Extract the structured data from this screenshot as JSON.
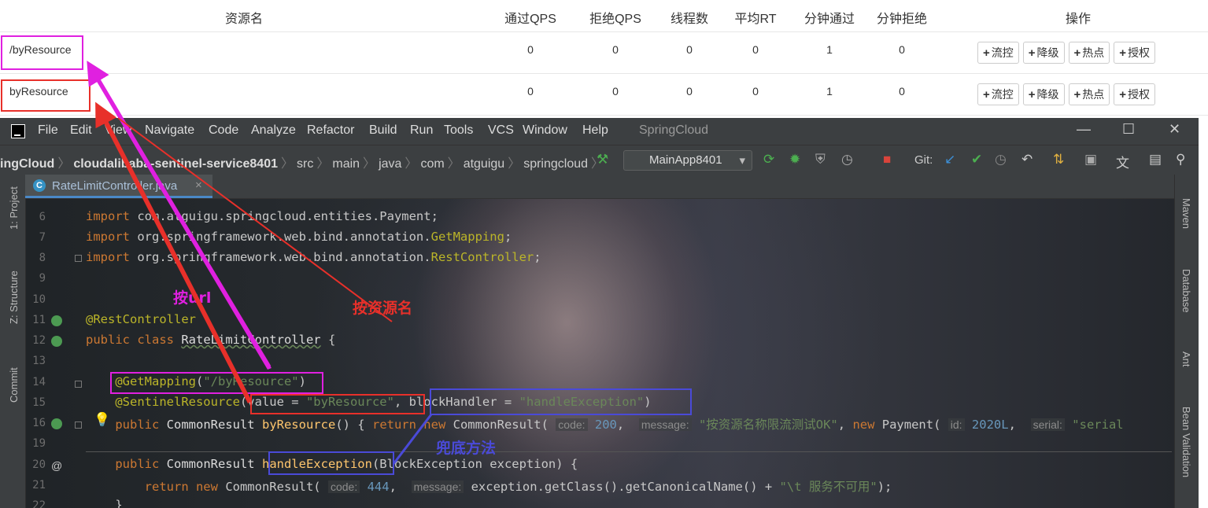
{
  "table": {
    "headers": [
      "资源名",
      "通过QPS",
      "拒绝QPS",
      "线程数",
      "平均RT",
      "分钟通过",
      "分钟拒绝",
      "操作"
    ],
    "rows": [
      {
        "name": "/byResource",
        "pass_qps": "0",
        "block_qps": "0",
        "threads": "0",
        "avg_rt": "0",
        "min_pass": "1",
        "min_block": "0"
      },
      {
        "name": "byResource",
        "pass_qps": "0",
        "block_qps": "0",
        "threads": "0",
        "avg_rt": "0",
        "min_pass": "1",
        "min_block": "0"
      }
    ],
    "actions": [
      "流控",
      "降级",
      "热点",
      "授权"
    ]
  },
  "ide": {
    "menu": [
      "File",
      "Edit",
      "View",
      "Navigate",
      "Code",
      "Analyze",
      "Refactor",
      "Build",
      "Run",
      "Tools",
      "VCS",
      "Window",
      "Help"
    ],
    "window_title": "SpringCloud",
    "breadcrumb": [
      "ingCloud",
      "cloudalibaba-sentinel-service8401",
      "src",
      "main",
      "java",
      "com",
      "atguigu",
      "springcloud"
    ],
    "run_config": "MainApp8401",
    "git_label": "Git:",
    "tab": "RateLimitController.java",
    "left_tools": [
      "1: Project",
      "Z: Structure",
      "Commit"
    ],
    "right_tools": [
      "Maven",
      "Database",
      "Ant",
      "Bean Validation"
    ],
    "lines": [
      {
        "n": "6",
        "text": "import com.atguigu.springcloud.entities.Payment;"
      },
      {
        "n": "7",
        "text": "import org.springframework.web.bind.annotation.GetMapping;"
      },
      {
        "n": "8",
        "text": "import org.springframework.web.bind.annotation.RestController;"
      },
      {
        "n": "9",
        "text": ""
      },
      {
        "n": "10",
        "text": ""
      },
      {
        "n": "11",
        "text": "@RestController"
      },
      {
        "n": "12",
        "text": "public class RateLimitController {"
      },
      {
        "n": "13",
        "text": ""
      },
      {
        "n": "14",
        "text": "    @GetMapping(\"/byResource\")"
      },
      {
        "n": "15",
        "text": "    @SentinelResource(value = \"byResource\", blockHandler = \"handleException\")"
      },
      {
        "n": "16",
        "text": "    public CommonResult byResource() { return new CommonResult( code: 200,  message: \"按资源名称限流测试OK\", new Payment( id: 2020L,  serial: \"serial"
      },
      {
        "n": "19",
        "text": ""
      },
      {
        "n": "20",
        "text": "    public CommonResult handleException(BlockException exception) {"
      },
      {
        "n": "21",
        "text": "        return new CommonResult( code: 444,  message: exception.getClass().getCanonicalName() + \"\\t 服务不可用\");"
      },
      {
        "n": "22",
        "text": "    }"
      }
    ],
    "hints": {
      "code": "code:",
      "message": "message:",
      "id": "id:",
      "serial": "serial:"
    }
  },
  "annotations": {
    "by_url": "按url",
    "by_resource_name": "按资源名",
    "fallback_method": "兜底方法"
  },
  "colors": {
    "magenta": "#e020e0",
    "red": "#e8302a",
    "blue": "#4a4ad8",
    "ide_bg": "#2b2b2b",
    "keyword": "#cc7832",
    "string": "#6a8759"
  }
}
